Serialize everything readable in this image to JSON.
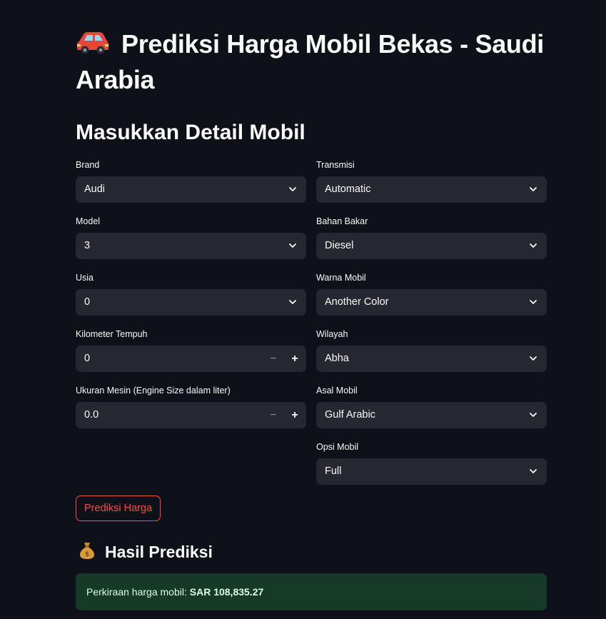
{
  "page": {
    "title": "Prediksi Harga Mobil Bekas - Saudi Arabia",
    "title_icon": "car-icon",
    "subheader": "Masukkan Detail Mobil"
  },
  "form": {
    "left": [
      {
        "type": "select",
        "label": "Brand",
        "value": "Audi"
      },
      {
        "type": "select",
        "label": "Model",
        "value": "3"
      },
      {
        "type": "select",
        "label": "Usia",
        "value": "0"
      },
      {
        "type": "number",
        "label": "Kilometer Tempuh",
        "value": "0",
        "minus": "−",
        "plus": "+"
      },
      {
        "type": "number",
        "label": "Ukuran Mesin (Engine Size dalam liter)",
        "value": "0.0",
        "minus": "−",
        "plus": "+"
      }
    ],
    "right": [
      {
        "type": "select",
        "label": "Transmisi",
        "value": "Automatic"
      },
      {
        "type": "select",
        "label": "Bahan Bakar",
        "value": "Diesel"
      },
      {
        "type": "select",
        "label": "Warna Mobil",
        "value": "Another Color"
      },
      {
        "type": "select",
        "label": "Wilayah",
        "value": "Abha"
      },
      {
        "type": "select",
        "label": "Asal Mobil",
        "value": "Gulf Arabic"
      },
      {
        "type": "select",
        "label": "Opsi Mobil",
        "value": "Full"
      }
    ]
  },
  "button": {
    "label": "Prediksi Harga"
  },
  "result": {
    "heading": "Hasil Prediksi",
    "heading_icon": "money-bag-icon",
    "prefix": "Perkiraan harga mobil: ",
    "value": "SAR 108,835.27"
  },
  "colors": {
    "background": "#0e1117",
    "input_bg": "#262730",
    "accent": "#ff4b4b",
    "success_bg": "#173928"
  }
}
